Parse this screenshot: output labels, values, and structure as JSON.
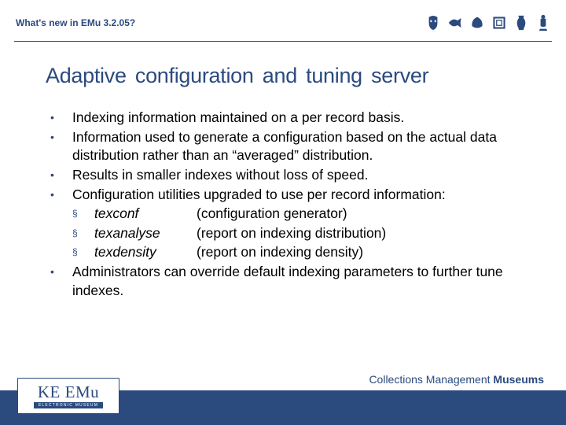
{
  "header": {
    "title": "What's new in EMu 3.2.05?"
  },
  "slide": {
    "title": "Adaptive configuration and tuning  server",
    "bullets": {
      "b0": "Indexing information maintained on a per record basis.",
      "b1": "Information used to generate a configuration based on the actual data distribution rather than an “averaged” distribution.",
      "b2": "Results in smaller indexes without loss of speed.",
      "b3": "Configuration utilities upgraded to use per record information:",
      "u0": {
        "name": "texconf",
        "desc": "(configuration generator)"
      },
      "u1": {
        "name": "texanalyse",
        "desc": "(report on indexing distribution)"
      },
      "u2": {
        "name": "texdensity",
        "desc": "(report on indexing density)"
      },
      "b4": "Administrators can override default indexing parameters to further tune indexes."
    }
  },
  "footer": {
    "tag1": "Collections Management ",
    "tag2": "Museums",
    "logo_main": "KE EMu",
    "logo_sub": "ELECTRONIC MUSEUM"
  }
}
